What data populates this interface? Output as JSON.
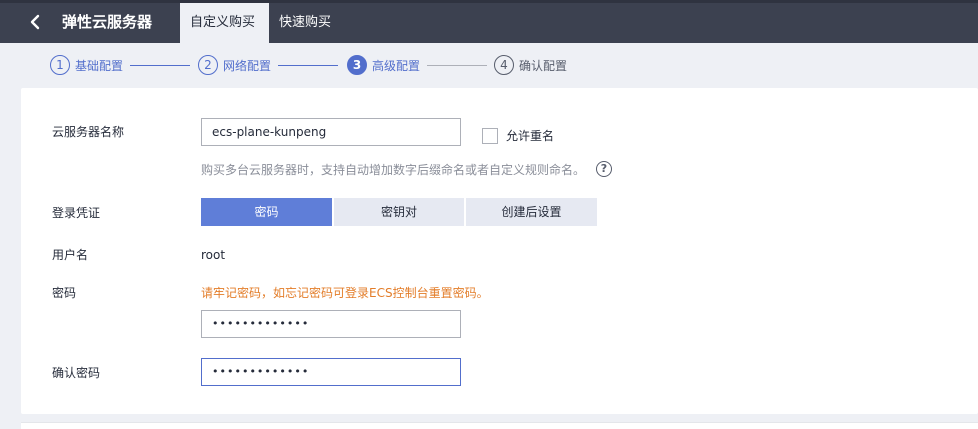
{
  "header": {
    "app_title": "弹性云服务器",
    "tabs": [
      {
        "label": "自定义购买",
        "active": true
      },
      {
        "label": "快速购买",
        "active": false
      }
    ]
  },
  "steps": [
    {
      "num": "1",
      "label": "基础配置",
      "state": "done"
    },
    {
      "num": "2",
      "label": "网络配置",
      "state": "done"
    },
    {
      "num": "3",
      "label": "高级配置",
      "state": "current"
    },
    {
      "num": "4",
      "label": "确认配置",
      "state": "todo"
    }
  ],
  "form": {
    "server_name": {
      "label": "云服务器名称",
      "value": "ecs-plane-kunpeng",
      "allow_duplicate_label": "允许重名",
      "allow_duplicate_checked": false,
      "hint": "购买多台云服务器时，支持自动增加数字后缀命名或者自定义规则命名。",
      "help_icon": "?"
    },
    "login_credential": {
      "label": "登录凭证",
      "options": [
        "密码",
        "密钥对",
        "创建后设置"
      ],
      "selected": "密码"
    },
    "username": {
      "label": "用户名",
      "value": "root"
    },
    "password": {
      "label": "密码",
      "warning": "请牢记密码，如忘记密码可登录ECS控制台重置密码。",
      "value": "•••••••••••••"
    },
    "confirm_password": {
      "label": "确认密码",
      "value": "•••••••••••••"
    }
  },
  "colors": {
    "topbar": "#3c4150",
    "accent_blue": "#526ecc",
    "active_segment": "#5f7ed8",
    "warning": "#e37d29",
    "page_bg": "#eef0f5"
  },
  "icons": {
    "back": "chevron-left-icon",
    "help": "question-circle-icon"
  }
}
